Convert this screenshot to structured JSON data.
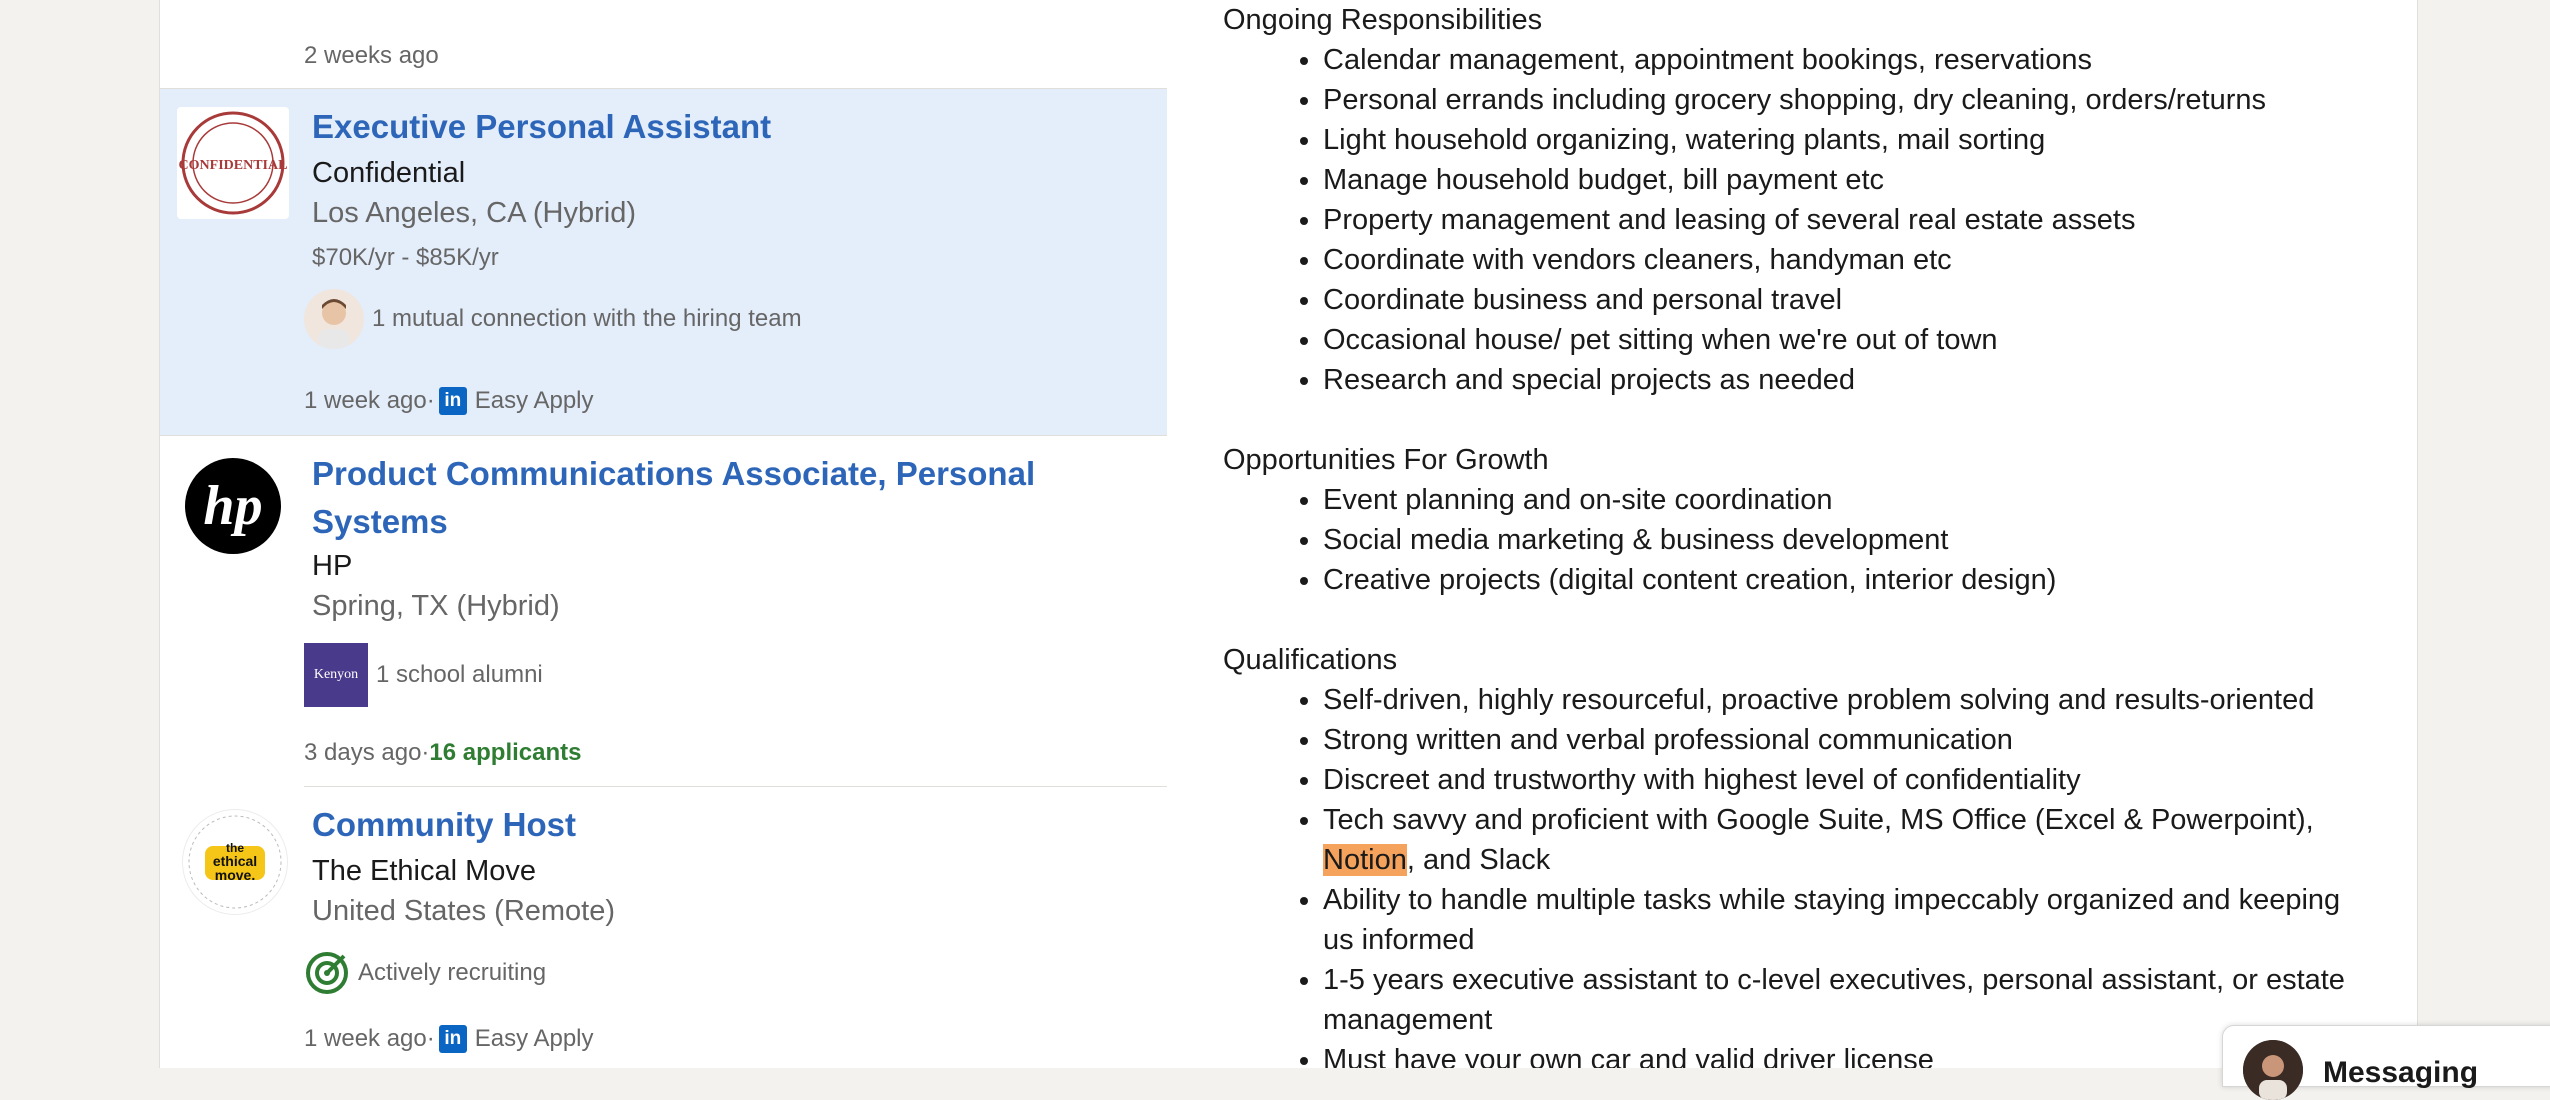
{
  "jobs": {
    "prev_footer": "2 weeks ago",
    "items": [
      {
        "title": "Executive Personal Assistant",
        "company": "Confidential",
        "location": "Los Angeles, CA (Hybrid)",
        "salary": "$70K/yr - $85K/yr",
        "insight": "1 mutual connection with the hiring team",
        "posted": "1 week ago",
        "sep": " · ",
        "easy_apply": "Easy Apply",
        "logo_text": "CONFIDENTIAL"
      },
      {
        "title_line1": "Product Communications Associate, Personal",
        "title_line2": "Systems",
        "company": "HP",
        "location": "Spring, TX (Hybrid)",
        "insight": "1 school alumni",
        "school_badge": "Kenyon",
        "posted": "3 days ago",
        "sep": " · ",
        "applicants": "16 applicants",
        "logo_text": "hp"
      },
      {
        "title": "Community Host",
        "company": "The Ethical Move",
        "location": "United States (Remote)",
        "insight": "Actively recruiting",
        "posted": "1 week ago",
        "sep": " · ",
        "easy_apply": "Easy Apply",
        "logo_line1": "the",
        "logo_line2": "ethical",
        "logo_line3": "move."
      }
    ]
  },
  "description": {
    "sections": [
      {
        "heading": "Ongoing Responsibilities",
        "items": [
          "Calendar management, appointment bookings, reservations",
          "Personal errands including grocery shopping, dry cleaning, orders/returns",
          "Light household organizing, watering plants, mail sorting",
          "Manage household budget, bill payment etc",
          "Property management and leasing of several real estate assets",
          "Coordinate with vendors cleaners, handyman etc",
          "Coordinate business and personal travel",
          "Occasional house/ pet sitting when we're out of town",
          "Research and special projects as needed"
        ]
      },
      {
        "heading": "Opportunities For Growth",
        "items": [
          "Event planning and on-site coordination",
          "Social media marketing & business development",
          "Creative projects (digital content creation, interior design)"
        ]
      },
      {
        "heading": "Qualifications",
        "items": [
          "Self-driven, highly resourceful, proactive problem solving and results-oriented",
          "Strong written and verbal professional communication",
          "Discreet and trustworthy with highest level of confidentiality"
        ],
        "tech_pre": "Tech savvy and proficient with Google Suite, MS Office (Excel & Powerpoint),",
        "tech_highlight": "Notion",
        "tech_post": ", and Slack",
        "items_after": [
          "Ability to handle multiple tasks while staying impeccably organized and keeping us informed",
          "1-5 years executive assistant to c-level executives, personal assistant, or estate management",
          "Must have your own car and valid driver license"
        ]
      }
    ]
  },
  "messaging": {
    "label": "Messaging"
  },
  "colors": {
    "link_blue": "#2d66b8",
    "selected_bg": "#e4edfa",
    "applicants_green": "#2e7d32",
    "highlight": "#f5a25d",
    "linkedin_blue": "#0a66c2"
  }
}
